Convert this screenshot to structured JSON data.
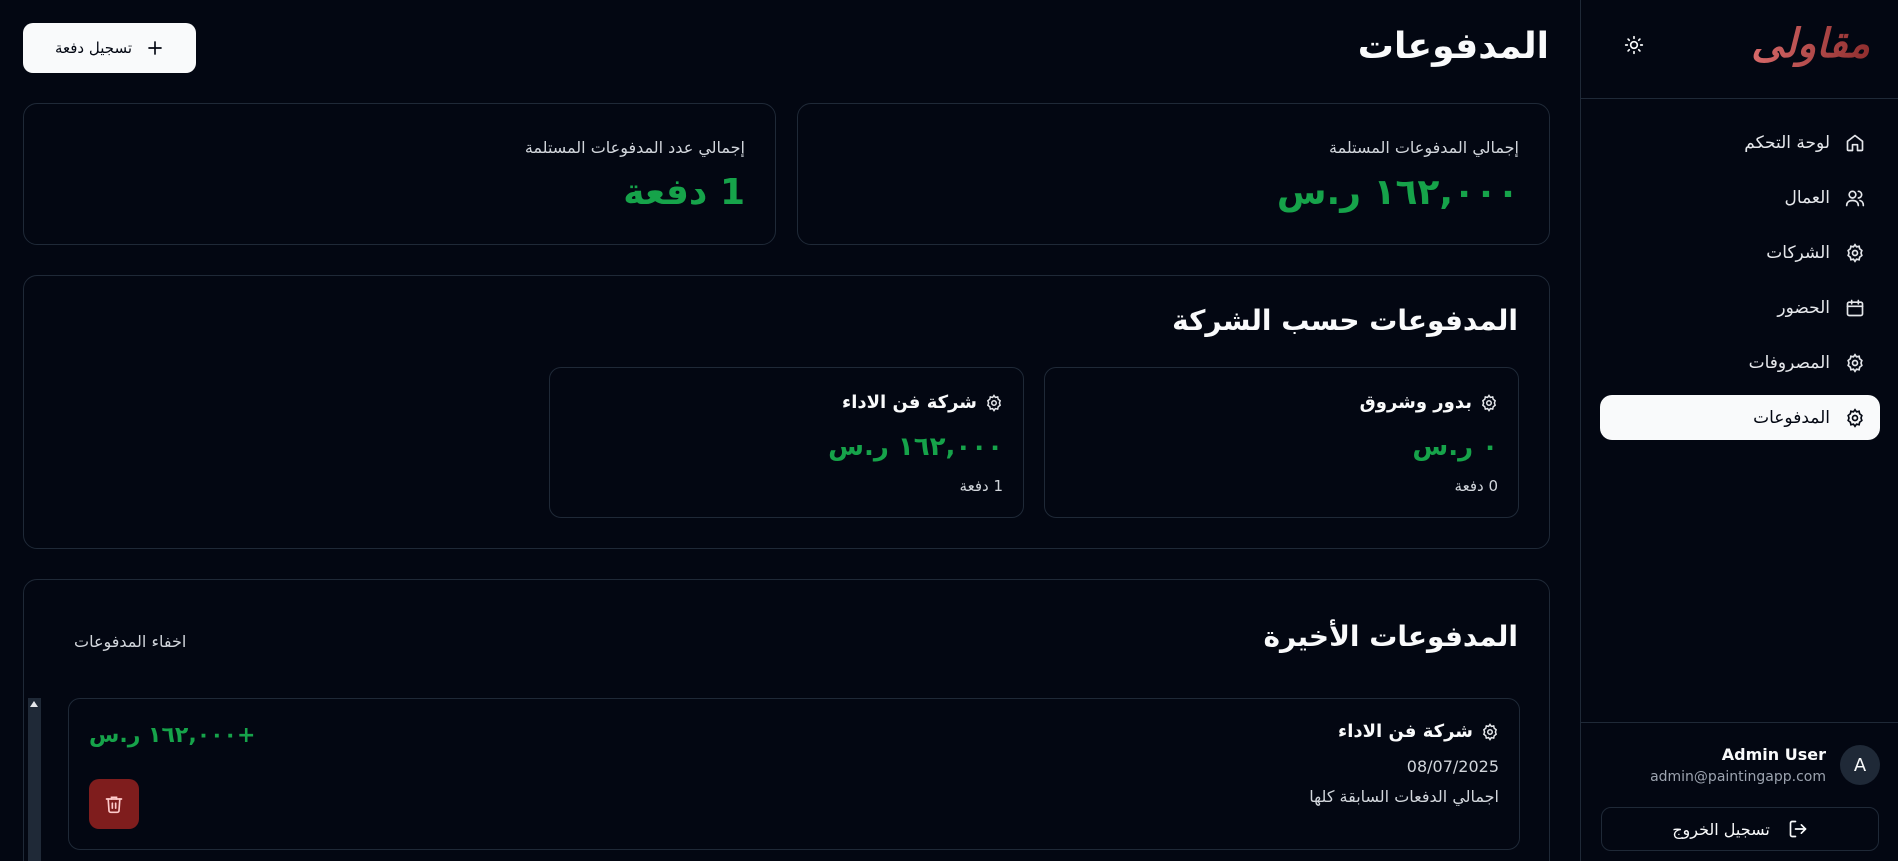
{
  "sidebar": {
    "logo": "مقاولى",
    "nav": [
      {
        "label": "لوحة التحكم",
        "icon": "home-icon"
      },
      {
        "label": "العمال",
        "icon": "users-icon"
      },
      {
        "label": "الشركات",
        "icon": "gear-icon"
      },
      {
        "label": "الحضور",
        "icon": "calendar-icon"
      },
      {
        "label": "المصروفات",
        "icon": "gear-icon"
      },
      {
        "label": "المدفوعات",
        "icon": "gear-icon",
        "active": true
      }
    ],
    "user": {
      "initial": "A",
      "name": "Admin User",
      "email": "admin@paintingapp.com"
    },
    "logout_label": "تسجيل الخروج"
  },
  "header": {
    "title": "المدفوعات",
    "add_button_label": "تسجيل دفعة"
  },
  "stats": [
    {
      "label": "إجمالي المدفوعات المستلمة",
      "value": "١٦٢,٠٠٠ ر.س"
    },
    {
      "label": "إجمالي عدد المدفوعات المستلمة",
      "value": "1 دفعة"
    }
  ],
  "by_company": {
    "title": "المدفوعات حسب الشركة",
    "companies": [
      {
        "name": "بدور وشروق",
        "amount": "٠ ر.س",
        "count": "0 دفعة"
      },
      {
        "name": "شركة فن الاداء",
        "amount": "١٦٢,٠٠٠ ر.س",
        "count": "1 دفعة"
      }
    ]
  },
  "recent": {
    "title": "المدفوعات الأخيرة",
    "hide_label": "اخفاء المدفوعات",
    "payments": [
      {
        "company": "شركة فن الاداء",
        "date": "08/07/2025",
        "note": "اجمالي الدفعات السابقة كلها",
        "amount": "+١٦٢,٠٠٠ ر.س"
      }
    ]
  },
  "colors": {
    "background": "#030712",
    "border": "#1f2937",
    "positive": "#16a34a",
    "danger": "#7f1d1d",
    "logo_gradient_start": "#d86a6a",
    "logo_gradient_end": "#8f2e2e"
  }
}
